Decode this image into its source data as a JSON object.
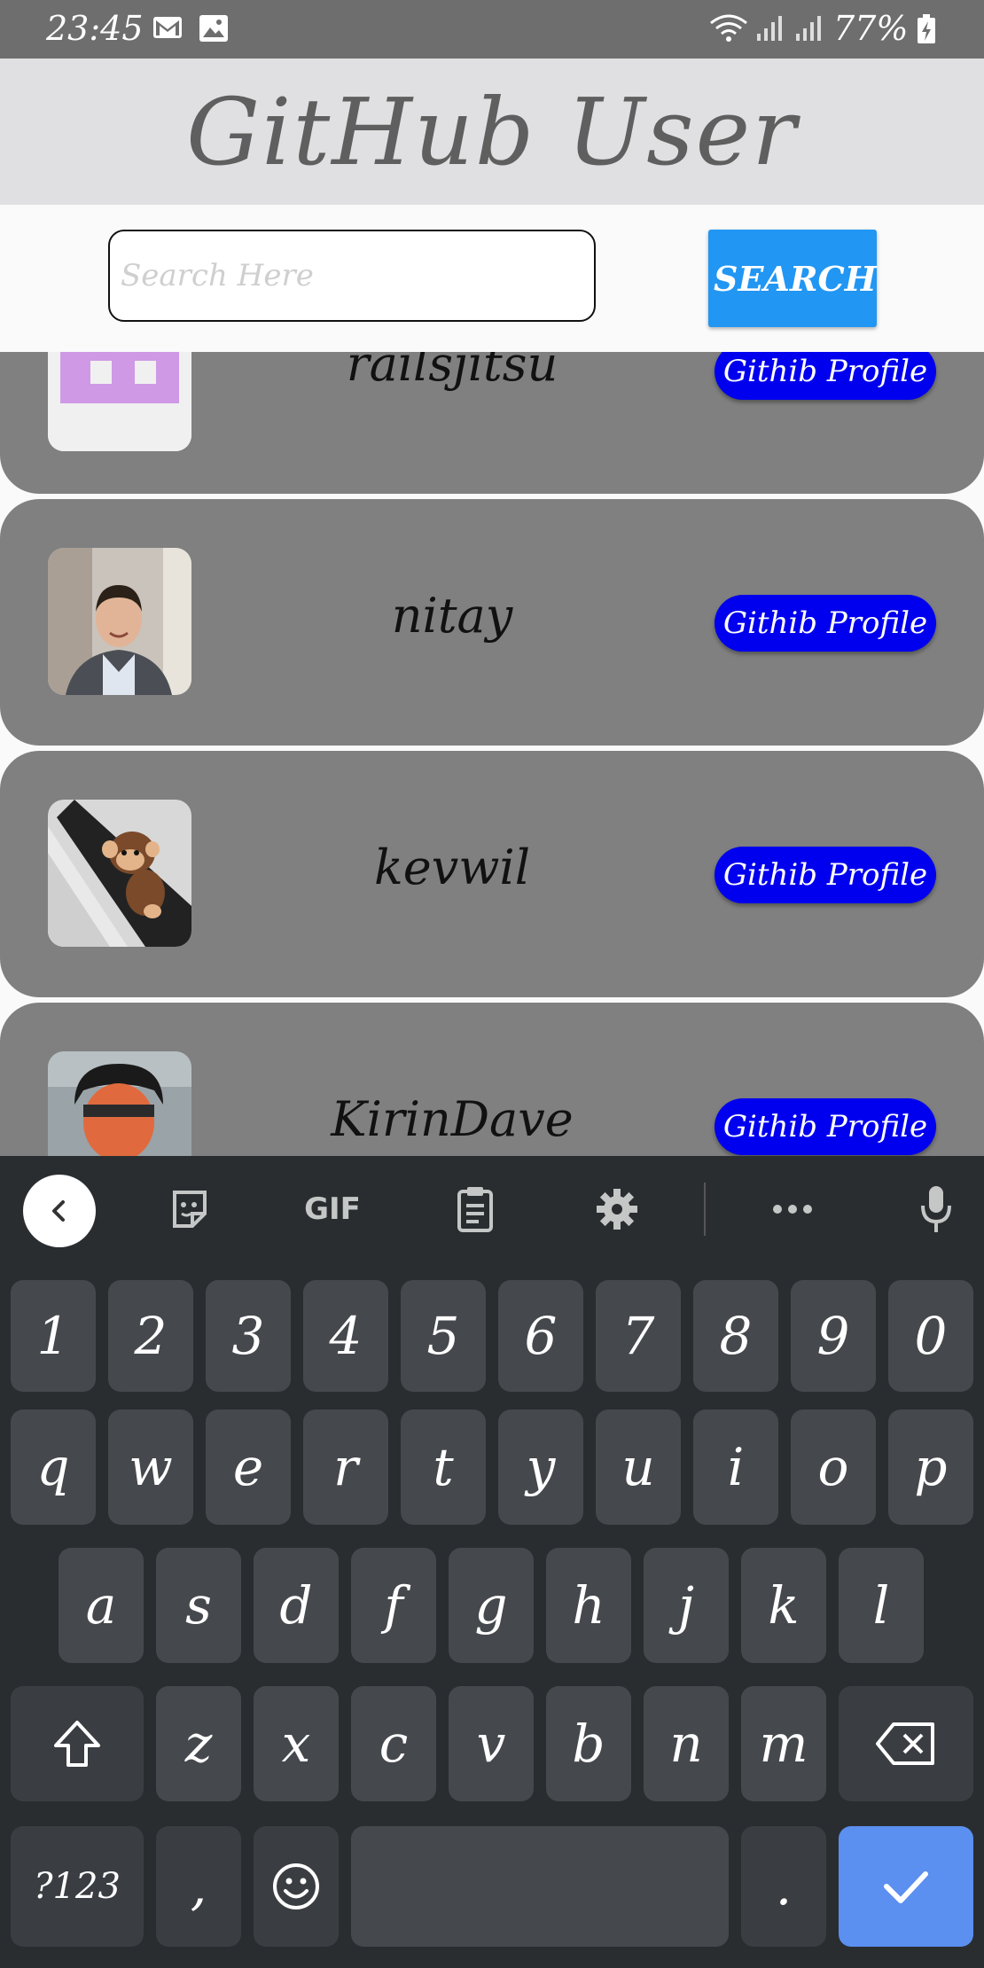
{
  "status_bar": {
    "time": "23:45",
    "battery": "77%",
    "icons": [
      "gmail-icon",
      "gallery-icon",
      "wifi-icon",
      "signal-icon",
      "signal-icon",
      "battery-charging-icon"
    ]
  },
  "header": {
    "title": "GitHub User"
  },
  "search": {
    "placeholder": "Search Here",
    "value": "",
    "button_label": "SEARCH"
  },
  "users": [
    {
      "username": "railsjitsu",
      "button_label": "Githib Profile"
    },
    {
      "username": "nitay",
      "button_label": "Githib Profile"
    },
    {
      "username": "kevwil",
      "button_label": "Githib Profile"
    },
    {
      "username": "KirinDave",
      "button_label": "Githib Profile"
    }
  ],
  "keyboard": {
    "toolbar": [
      "back-icon",
      "sticker-icon",
      "GIF",
      "clipboard-icon",
      "settings-icon",
      "more-icon",
      "mic-icon"
    ],
    "gif_label": "GIF",
    "row1": [
      "1",
      "2",
      "3",
      "4",
      "5",
      "6",
      "7",
      "8",
      "9",
      "0"
    ],
    "row2": [
      "q",
      "w",
      "e",
      "r",
      "t",
      "y",
      "u",
      "i",
      "o",
      "p"
    ],
    "row3": [
      "a",
      "s",
      "d",
      "f",
      "g",
      "h",
      "j",
      "k",
      "l"
    ],
    "row4": [
      "z",
      "x",
      "c",
      "v",
      "b",
      "n",
      "m"
    ],
    "symbols_label": "?123",
    "comma": ",",
    "period": "."
  },
  "colors": {
    "header_bg": "#e0e0e2",
    "search_button": "#2196f3",
    "card_bg": "#808080",
    "profile_button": "#0000ee",
    "keyboard_bg": "#2a2d30",
    "enter_key": "#5b8ff0"
  }
}
